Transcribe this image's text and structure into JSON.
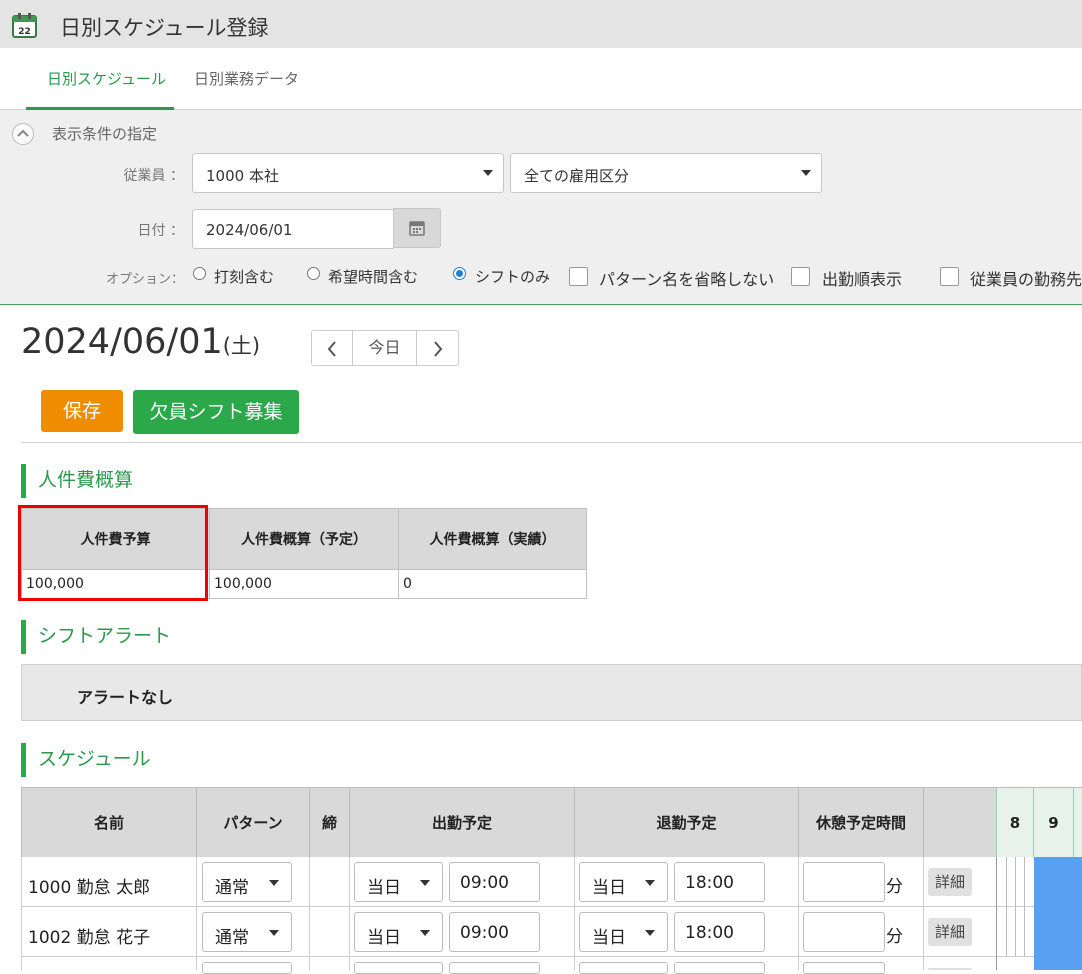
{
  "header": {
    "title": "日別スケジュール登録",
    "icon": "calendar-icon"
  },
  "tabs": [
    {
      "label": "日別スケジュール",
      "active": true
    },
    {
      "label": "日別業務データ",
      "active": false
    }
  ],
  "filter": {
    "heading": "表示条件の指定",
    "employee_label": "従業員 ：",
    "employee_value": "1000 本社",
    "employment_value": "全ての雇用区分",
    "date_label": "日付 ：",
    "date_value": "2024/06/01",
    "options_label": "オプション：",
    "radios": [
      {
        "label": "打刻含む",
        "checked": false
      },
      {
        "label": "希望時間含む",
        "checked": false
      },
      {
        "label": "シフトのみ",
        "checked": true
      }
    ],
    "checkboxes": [
      {
        "label": "パターン名を省略しない",
        "checked": false
      },
      {
        "label": "出勤順表示",
        "checked": false
      },
      {
        "label": "従業員の勤務先",
        "checked": false
      }
    ]
  },
  "date_display": {
    "date": "2024/06/01",
    "weekday": "(土)"
  },
  "nav": {
    "prev": "‹",
    "today": "今日",
    "next": "›"
  },
  "actions": {
    "save": "保存",
    "recruit": "欠員シフト募集"
  },
  "cost": {
    "title": "人件費概算",
    "headers": [
      "人件費予算",
      "人件費概算（予定）",
      "人件費概算（実績）"
    ],
    "values": [
      "100,000",
      "100,000",
      "0"
    ]
  },
  "alert": {
    "title": "シフトアラート",
    "message": "アラートなし"
  },
  "schedule": {
    "title": "スケジュール",
    "columns": [
      "名前",
      "パターン",
      "締",
      "出勤予定",
      "退勤予定",
      "休憩予定時間"
    ],
    "hours": [
      "8",
      "9"
    ],
    "rows": [
      {
        "name": "1000 勤怠 太郎",
        "pattern": "通常",
        "in_day": "当日",
        "in_time": "09:00",
        "out_day": "当日",
        "out_time": "18:00",
        "break": "",
        "unit": "分",
        "detail": "詳細"
      },
      {
        "name": "1002 勤怠 花子",
        "pattern": "通常",
        "in_day": "当日",
        "in_time": "09:00",
        "out_day": "当日",
        "out_time": "18:00",
        "break": "",
        "unit": "分",
        "detail": "詳細"
      },
      {
        "name": "",
        "pattern": "",
        "in_day": "",
        "in_time": "",
        "out_day": "",
        "out_time": "",
        "break": "",
        "unit": "",
        "detail": ""
      }
    ]
  },
  "colors": {
    "accent": "#2aa84a",
    "save": "#f08c00",
    "bar": "#5aa0f0",
    "highlight": "#ee0000"
  }
}
